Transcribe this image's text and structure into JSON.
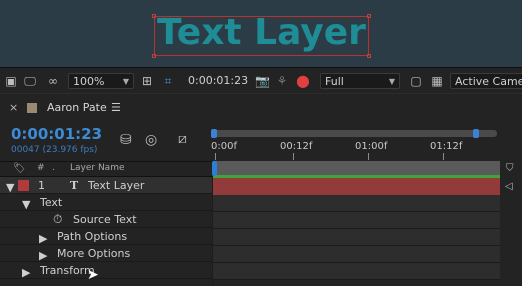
{
  "viewer": {
    "text": "Text Layer"
  },
  "viewer_toolbar": {
    "zoom": "100%",
    "time": "0:00:01:23",
    "resolution": "Full",
    "view": "Active Camer"
  },
  "panel": {
    "comp_name": "Aaron Pate",
    "menu_icon": "hamburger-icon"
  },
  "timeline": {
    "timecode": "0:00:01:23",
    "frames": "00047 (23.976 fps)",
    "ticks": [
      "0:00f",
      "00:12f",
      "01:00f",
      "01:12f"
    ]
  },
  "columns": {
    "number": "#",
    "layer_name": "Layer Name"
  },
  "layers": {
    "layer1_number": "1",
    "layer1_type": "T",
    "layer1_name": "Text Layer",
    "text_group": "Text",
    "source_text": "Source Text",
    "path_options": "Path Options",
    "more_options": "More Options",
    "transform": "Transform"
  },
  "colors": {
    "accent": "#3d8bd6",
    "layer_label": "#b23a3a",
    "text_fill": "#1e8d96"
  }
}
